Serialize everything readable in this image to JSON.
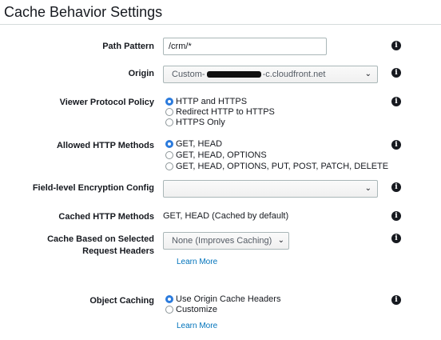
{
  "page": {
    "title": "Cache Behavior Settings"
  },
  "path_pattern": {
    "label": "Path Pattern",
    "value": "/crm/*"
  },
  "origin": {
    "label": "Origin",
    "value_prefix": "Custom-",
    "value_suffix": "-c.cloudfront.net"
  },
  "viewer_protocol": {
    "label": "Viewer Protocol Policy",
    "options": [
      "HTTP and HTTPS",
      "Redirect HTTP to HTTPS",
      "HTTPS Only"
    ],
    "selected": 0
  },
  "allowed_methods": {
    "label": "Allowed HTTP Methods",
    "options": [
      "GET, HEAD",
      "GET, HEAD, OPTIONS",
      "GET, HEAD, OPTIONS, PUT, POST, PATCH, DELETE"
    ],
    "selected": 0
  },
  "field_level": {
    "label": "Field-level Encryption Config",
    "value": ""
  },
  "cached_methods": {
    "label": "Cached HTTP Methods",
    "value": "GET, HEAD (Cached by default)"
  },
  "cache_headers": {
    "label_line1": "Cache Based on Selected",
    "label_line2": "Request Headers",
    "value": "None (Improves Caching)",
    "learn_more": "Learn More"
  },
  "object_caching": {
    "label": "Object Caching",
    "options": [
      "Use Origin Cache Headers",
      "Customize"
    ],
    "selected": 0,
    "learn_more": "Learn More"
  },
  "icons": {
    "info": "info-icon",
    "dropdown": "chevron-down-icon"
  },
  "colors": {
    "accent": "#2b7bdd",
    "link": "#0073bb",
    "border": "#aab7b8"
  }
}
